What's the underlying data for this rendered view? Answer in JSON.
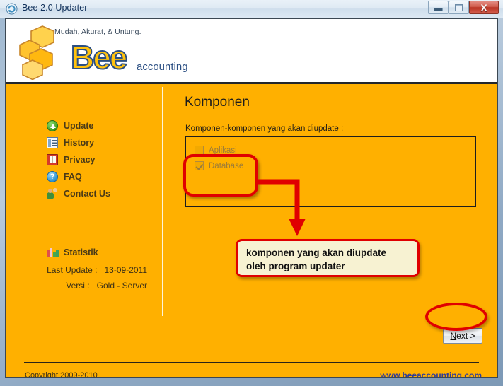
{
  "window": {
    "title": "Bee 2.0 Updater",
    "icon": "update-circle-icon",
    "controls": {
      "minimize": "minimize-button",
      "maximize": "maximize-button",
      "close_glyph": "X"
    }
  },
  "brand": {
    "tagline": "Mudah, Akurat, & Untung.",
    "wordmark": "Bee",
    "subword": "accounting",
    "logo_colors": {
      "hex_fill": "#FFC83C",
      "hex_stroke": "#C8862A",
      "word_fill": "#FFC20E",
      "word_stroke": "#2B4F83",
      "subword": "#2B4F83"
    }
  },
  "sidebar": {
    "items": [
      {
        "label": "Update",
        "icon": "update-icon"
      },
      {
        "label": "History",
        "icon": "history-icon"
      },
      {
        "label": "Privacy",
        "icon": "privacy-book-icon"
      },
      {
        "label": "FAQ",
        "icon": "faq-question-icon",
        "glyph": "?"
      },
      {
        "label": "Contact Us",
        "icon": "contact-person-icon"
      }
    ],
    "stats": {
      "heading": "Statistik",
      "heading_icon": "bar-chart-icon",
      "last_update_label": "Last Update :",
      "last_update_value": "13-09-2011",
      "versi_label": "Versi :",
      "versi_value": "Gold - Server"
    }
  },
  "content": {
    "title": "Komponen",
    "description": "Komponen-komponen yang akan diupdate :",
    "components": [
      {
        "label": "Aplikasi",
        "checked": false,
        "enabled": false
      },
      {
        "label": "Database",
        "checked": true,
        "enabled": false
      }
    ]
  },
  "annotations": {
    "accent_color": "#E00000",
    "callout_bg": "#F7F2D2",
    "callout_lines": [
      "komponen yang akan diupdate",
      "oleh program updater"
    ],
    "highlight_target": "component-checkbox-group",
    "ellipse_target": "next-button"
  },
  "actions": {
    "next_prefix": "N",
    "next_suffix": "ext >"
  },
  "footer": {
    "copyright": "Copyright 2009-2010",
    "website": "www.beeaccounting.com",
    "website_color": "#2C3B9C"
  },
  "theme": {
    "body_orange": "#FFB000",
    "header_white": "#FFFFFF",
    "rule_dark": "#22262B"
  }
}
